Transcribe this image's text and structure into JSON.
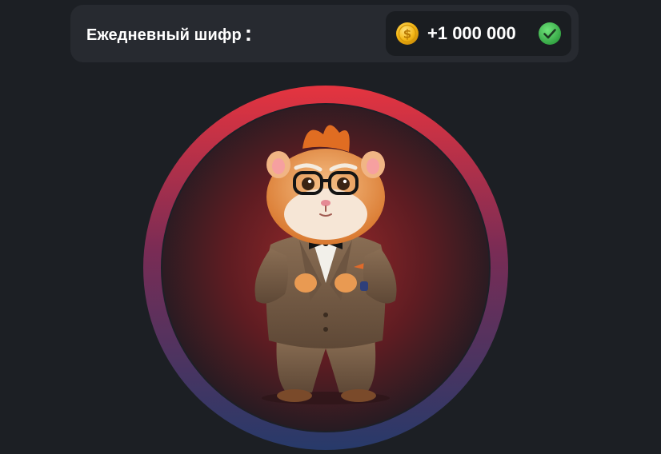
{
  "cipher": {
    "title": "Ежедневный шифр",
    "colon": ":",
    "reward": "+1 000 000",
    "status": "claimed"
  },
  "icons": {
    "coin": "coin-icon",
    "check": "check-circle-icon",
    "mascot": "hamster-mascot-icon"
  },
  "colors": {
    "background": "#1c1f24",
    "bar": "#272a30",
    "pill": "#1a1d21",
    "ring_top": "#e5343f",
    "ring_bottom": "#273a6a",
    "coin": "#f4b716",
    "check": "#3fb94e"
  }
}
